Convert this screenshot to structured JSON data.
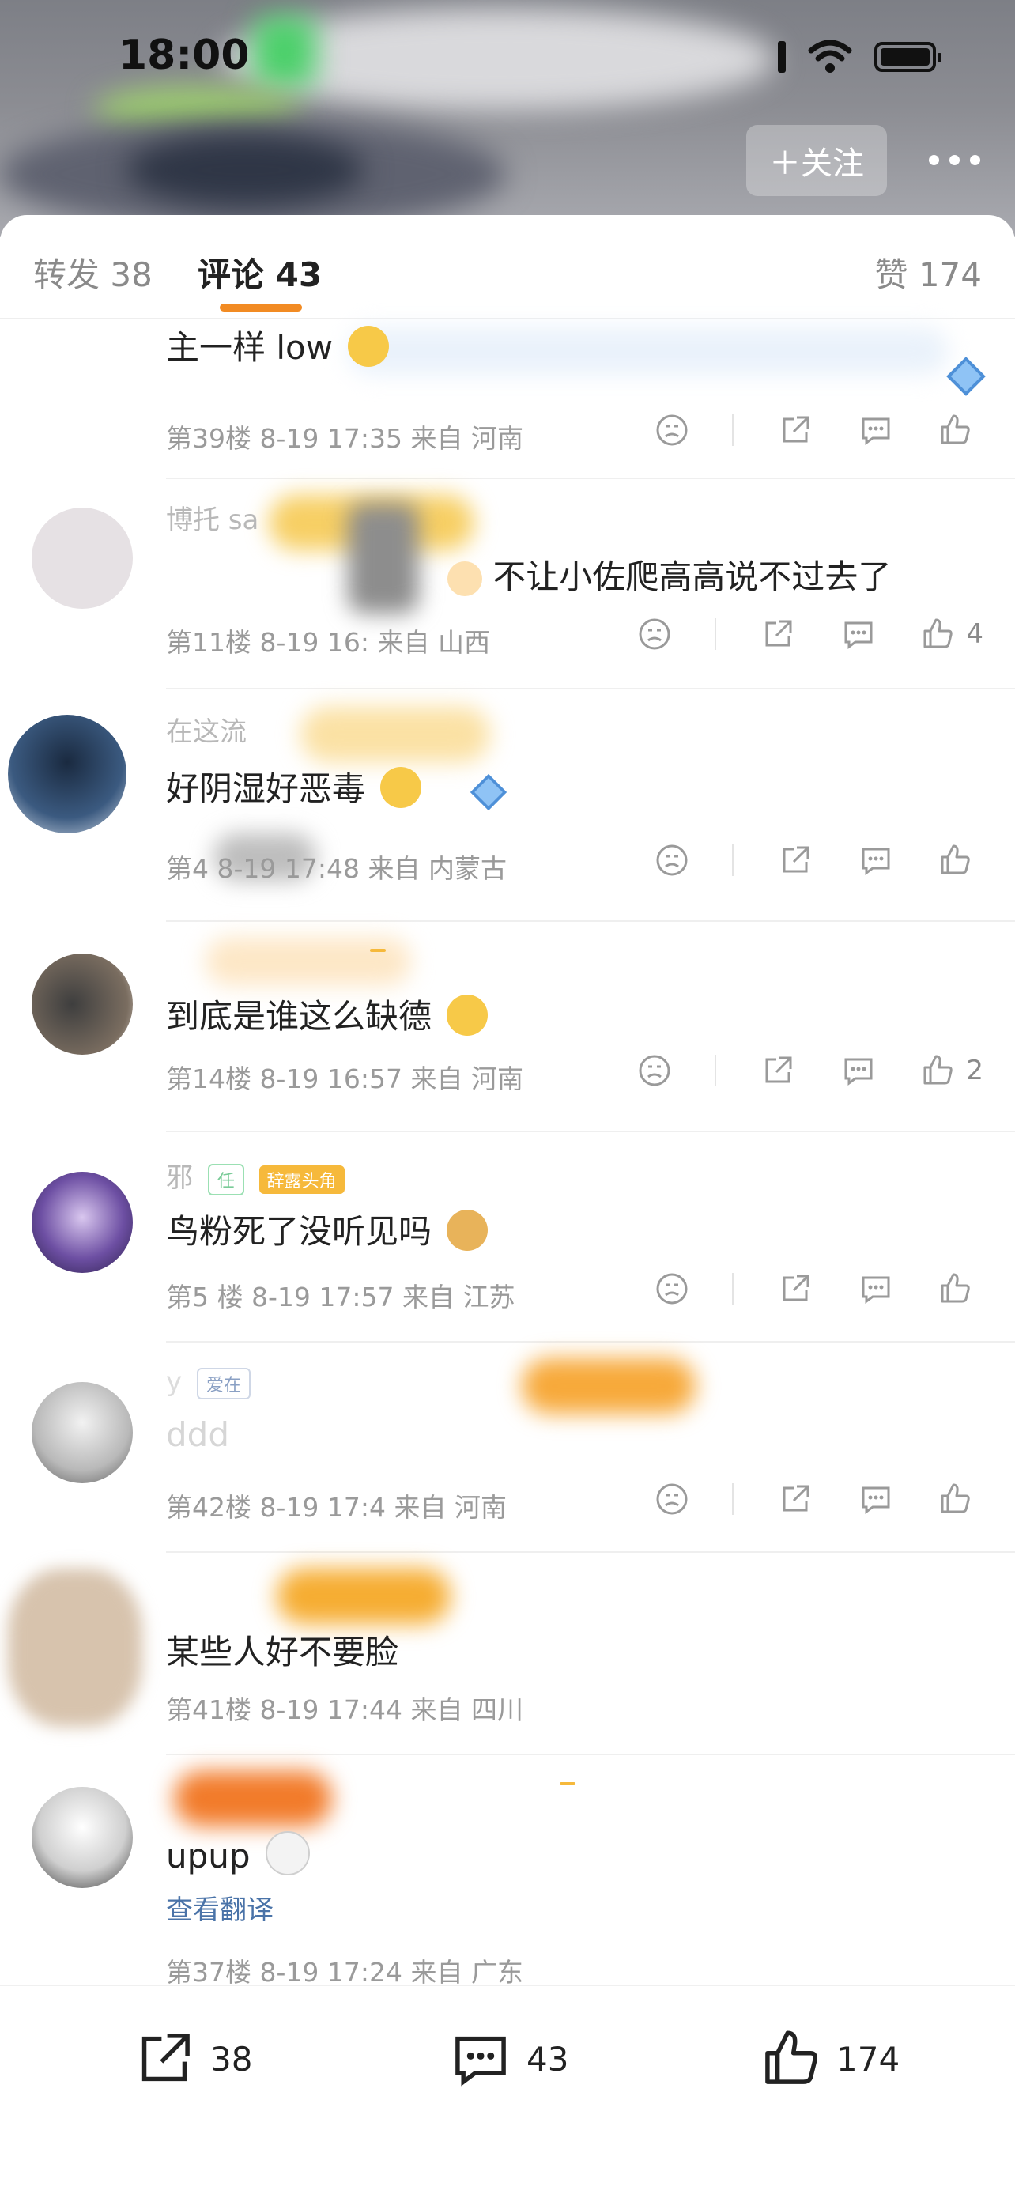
{
  "status_bar": {
    "time": "18:00"
  },
  "header": {
    "follow_label": "＋关注",
    "more_icon": "more-dots-icon"
  },
  "tabs": {
    "repost": "转发 38",
    "comments": "评论 43",
    "likes": "赞 174"
  },
  "comments": [
    {
      "text": "主一样 low",
      "meta": "第39楼 8-19 17:35  来自 河南",
      "likes": ""
    },
    {
      "name": "博托 sa",
      "text": "不让小佐爬高高说不过去了",
      "meta": "第11楼 8-19 16:  来自 山西",
      "likes": "4"
    },
    {
      "name": "在这流",
      "text": "好阴湿好恶毒",
      "meta": "第4  8-19 17:48  来自 内蒙古",
      "likes": ""
    },
    {
      "name": "",
      "text": "到底是谁这么缺德",
      "meta": "第14楼 8-19 16:57  来自 河南",
      "likes": "2"
    },
    {
      "name": "邪",
      "badge": "辞露头角",
      "text": "鸟粉死了没听见吗",
      "meta": "第5 楼 8-19 17:57  来自 江苏",
      "likes": ""
    },
    {
      "name": "y",
      "badge": "爱在",
      "text": "ddd",
      "meta": "第42楼 8-19 17:4  来自 河南",
      "likes": ""
    },
    {
      "name": "",
      "text": "某些人好不要脸",
      "meta": "第41楼 8-19 17:44  来自 四川",
      "likes": ""
    },
    {
      "name": "",
      "text": "upup",
      "translate": "查看翻译",
      "meta": "第37楼 8-19 17:24  来自 广东",
      "likes": ""
    }
  ],
  "bottom_bar": {
    "repost_count": "38",
    "comment_count": "43",
    "like_count": "174"
  },
  "colors": {
    "accent": "#f28b23",
    "link": "#4a73a8"
  }
}
